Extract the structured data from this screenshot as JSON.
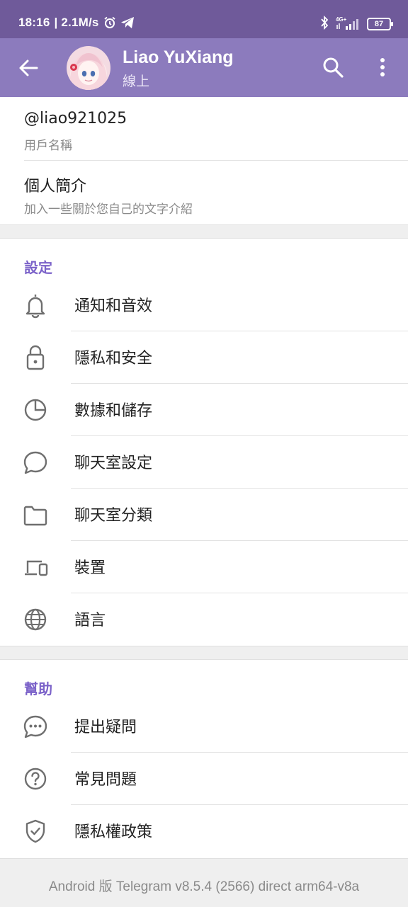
{
  "status_bar": {
    "time": "18:16",
    "speed": "| 2.1M/s",
    "network": "4G+",
    "battery": "87"
  },
  "app_bar": {
    "name": "Liao YuXiang",
    "status": "線上"
  },
  "profile": {
    "username": "@liao921025",
    "username_caption": "用戶名稱",
    "bio_title": "個人簡介",
    "bio_hint": "加入一些關於您自己的文字介紹"
  },
  "settings": {
    "header": "設定",
    "items": [
      {
        "label": "通知和音效",
        "icon": "bell-icon"
      },
      {
        "label": "隱私和安全",
        "icon": "lock-icon"
      },
      {
        "label": "數據和儲存",
        "icon": "pie-chart-icon"
      },
      {
        "label": "聊天室設定",
        "icon": "chat-bubble-icon"
      },
      {
        "label": "聊天室分類",
        "icon": "folder-icon"
      },
      {
        "label": "裝置",
        "icon": "devices-icon"
      },
      {
        "label": "語言",
        "icon": "globe-icon"
      }
    ]
  },
  "help": {
    "header": "幫助",
    "items": [
      {
        "label": "提出疑問",
        "icon": "chat-dots-icon"
      },
      {
        "label": "常見問題",
        "icon": "question-icon"
      },
      {
        "label": "隱私權政策",
        "icon": "shield-check-icon"
      }
    ]
  },
  "footer": {
    "version": "Android 版 Telegram v8.5.4 (2566) direct arm64-v8a"
  },
  "colors": {
    "status_bar": "#6f5a9a",
    "app_bar": "#8c7bbd",
    "accent": "#7b62c9",
    "icon": "#6f6f6f"
  }
}
